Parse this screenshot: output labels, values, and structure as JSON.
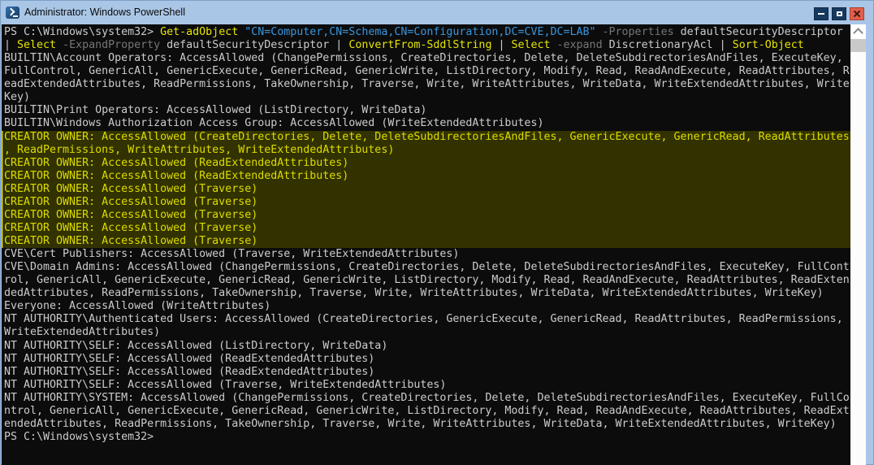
{
  "window": {
    "title": "Administrator: Windows PowerShell"
  },
  "colors": {
    "console_bg": "#0C0C0C",
    "console_fg": "#CCCCCC",
    "cmdlet_yellow": "#E5E500",
    "string_cyan": "#3A96DD",
    "param_gray": "#767676",
    "highlight_fg": "#DCDC00",
    "highlight_bg": "#323200",
    "highlight_edge": "#A2A200",
    "titlebar_bg": "#A9C6E6",
    "close_red": "#E0604C"
  },
  "icons": [
    "powershell-icon",
    "minimize-icon",
    "maximize-icon",
    "close-icon",
    "scroll-up-icon"
  ],
  "terminal": {
    "prompt": "PS C:\\Windows\\system32>",
    "lines": [
      {
        "seg": [
          [
            "d",
            "PS C:\\Windows\\system32> "
          ],
          [
            "y",
            "Get-adObject "
          ],
          [
            "s",
            "\"CN=Computer,CN=Schema,CN=Configuration,DC=CVE,DC=LAB\""
          ],
          [
            "d",
            " "
          ],
          [
            "p",
            "-Properties"
          ],
          [
            "d",
            " defaultSecurityDescriptor"
          ]
        ]
      },
      {
        "seg": [
          [
            "d",
            "| "
          ],
          [
            "y",
            "Select "
          ],
          [
            "p",
            "-ExpandProperty"
          ],
          [
            "d",
            " defaultSecurityDescriptor | "
          ],
          [
            "y",
            "ConvertFrom-SddlString"
          ],
          [
            "d",
            " | "
          ],
          [
            "y",
            "Select "
          ],
          [
            "p",
            "-expand"
          ],
          [
            "d",
            " DiscretionaryAcl | "
          ],
          [
            "y",
            "Sort-Object"
          ]
        ]
      },
      {
        "text": "BUILTIN\\Account Operators: AccessAllowed (ChangePermissions, CreateDirectories, Delete, DeleteSubdirectoriesAndFiles, ExecuteKey,"
      },
      {
        "text": "FullControl, GenericAll, GenericExecute, GenericRead, GenericWrite, ListDirectory, Modify, Read, ReadAndExecute, ReadAttributes, R"
      },
      {
        "text": "eadExtendedAttributes, ReadPermissions, TakeOwnership, Traverse, Write, WriteAttributes, WriteData, WriteExtendedAttributes, Write"
      },
      {
        "text": "Key)"
      },
      {
        "text": "BUILTIN\\Print Operators: AccessAllowed (ListDirectory, WriteData)"
      },
      {
        "text": "BUILTIN\\Windows Authorization Access Group: AccessAllowed (WriteExtendedAttributes)"
      },
      {
        "text": "CREATOR OWNER: AccessAllowed (CreateDirectories, Delete, DeleteSubdirectoriesAndFiles, GenericExecute, GenericRead, ReadAttributes",
        "hl": true
      },
      {
        "text": ", ReadPermissions, WriteAttributes, WriteExtendedAttributes)",
        "hl": true
      },
      {
        "text": "CREATOR OWNER: AccessAllowed (ReadExtendedAttributes)",
        "hl": true
      },
      {
        "text": "CREATOR OWNER: AccessAllowed (ReadExtendedAttributes)",
        "hl": true
      },
      {
        "text": "CREATOR OWNER: AccessAllowed (Traverse)",
        "hl": true
      },
      {
        "text": "CREATOR OWNER: AccessAllowed (Traverse)",
        "hl": true
      },
      {
        "text": "CREATOR OWNER: AccessAllowed (Traverse)",
        "hl": true
      },
      {
        "text": "CREATOR OWNER: AccessAllowed (Traverse)",
        "hl": true
      },
      {
        "text": "CREATOR OWNER: AccessAllowed (Traverse)",
        "hl": true
      },
      {
        "text": "CVE\\Cert Publishers: AccessAllowed (Traverse, WriteExtendedAttributes)"
      },
      {
        "text": "CVE\\Domain Admins: AccessAllowed (ChangePermissions, CreateDirectories, Delete, DeleteSubdirectoriesAndFiles, ExecuteKey, FullCont"
      },
      {
        "text": "rol, GenericAll, GenericExecute, GenericRead, GenericWrite, ListDirectory, Modify, Read, ReadAndExecute, ReadAttributes, ReadExten"
      },
      {
        "text": "dedAttributes, ReadPermissions, TakeOwnership, Traverse, Write, WriteAttributes, WriteData, WriteExtendedAttributes, WriteKey)"
      },
      {
        "text": "Everyone: AccessAllowed (WriteAttributes)"
      },
      {
        "text": "NT AUTHORITY\\Authenticated Users: AccessAllowed (CreateDirectories, GenericExecute, GenericRead, ReadAttributes, ReadPermissions,"
      },
      {
        "text": "WriteExtendedAttributes)"
      },
      {
        "text": "NT AUTHORITY\\SELF: AccessAllowed (ListDirectory, WriteData)"
      },
      {
        "text": "NT AUTHORITY\\SELF: AccessAllowed (ReadExtendedAttributes)"
      },
      {
        "text": "NT AUTHORITY\\SELF: AccessAllowed (ReadExtendedAttributes)"
      },
      {
        "text": "NT AUTHORITY\\SELF: AccessAllowed (Traverse, WriteExtendedAttributes)"
      },
      {
        "text": "NT AUTHORITY\\SYSTEM: AccessAllowed (ChangePermissions, CreateDirectories, Delete, DeleteSubdirectoriesAndFiles, ExecuteKey, FullCo"
      },
      {
        "text": "ntrol, GenericAll, GenericExecute, GenericRead, GenericWrite, ListDirectory, Modify, Read, ReadAndExecute, ReadAttributes, ReadExt"
      },
      {
        "text": "endedAttributes, ReadPermissions, TakeOwnership, Traverse, Write, WriteAttributes, WriteData, WriteExtendedAttributes, WriteKey)"
      },
      {
        "text": "PS C:\\Windows\\system32> "
      }
    ]
  }
}
